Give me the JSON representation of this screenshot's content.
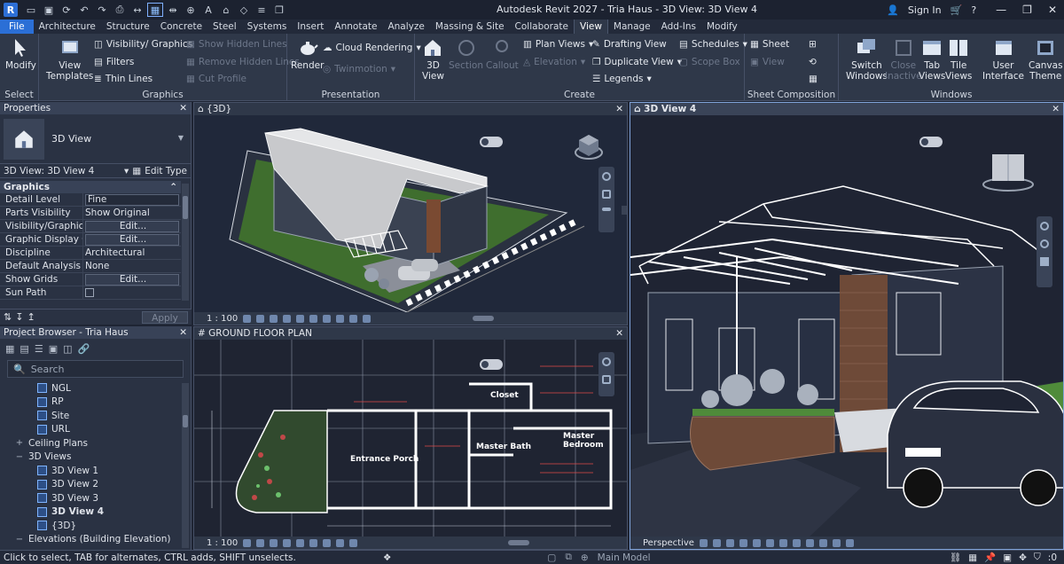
{
  "app": {
    "title": "Autodesk Revit 2027 - Tria Haus - 3D View: 3D View 4",
    "logo_letter": "R",
    "sign_in": "Sign In",
    "help": "?"
  },
  "tabs": [
    "File",
    "Architecture",
    "Structure",
    "Concrete",
    "Steel",
    "Systems",
    "Insert",
    "Annotate",
    "Analyze",
    "Massing & Site",
    "Collaborate",
    "View",
    "Manage",
    "Add-Ins",
    "Modify"
  ],
  "active_tab": "View",
  "ribbon": {
    "select": {
      "modify": "Modify",
      "title": "Select"
    },
    "graphics": {
      "view_templates_1": "View",
      "view_templates_2": "Templates",
      "visibility": "Visibility/ Graphics",
      "filters": "Filters",
      "thin_lines": "Thin Lines",
      "show_hidden": "Show Hidden Lines",
      "remove_hidden": "Remove Hidden Lines",
      "cut_profile": "Cut Profile",
      "title": "Graphics"
    },
    "presentation": {
      "render": "Render",
      "cloud": "Cloud Rendering",
      "twinmotion": "Twinmotion",
      "title": "Presentation"
    },
    "create": {
      "view3d_1": "3D",
      "view3d_2": "View",
      "section": "Section",
      "callout": "Callout",
      "plan_views": "Plan Views",
      "elevation": "Elevation",
      "drafting": "Drafting View",
      "duplicate": "Duplicate View",
      "legends": "Legends",
      "schedules": "Schedules",
      "scope_box": "Scope Box",
      "title": "Create"
    },
    "sheet": {
      "sheet": "Sheet",
      "view": "View",
      "title": "Sheet Composition"
    },
    "windows": {
      "switch_1": "Switch",
      "switch_2": "Windows",
      "close_1": "Close",
      "close_2": "Inactive",
      "tab_1": "Tab",
      "tab_2": "Views",
      "tile_1": "Tile",
      "tile_2": "Views",
      "user_1": "User",
      "user_2": "Interface",
      "canvas_1": "Canvas",
      "canvas_2": "Theme",
      "title": "Windows"
    }
  },
  "properties": {
    "title": "Properties",
    "type_name": "3D View",
    "view_selector": "3D View: 3D View 4",
    "edit_type": "Edit Type",
    "section": "Graphics",
    "rows": [
      {
        "k": "Detail Level",
        "v": "Fine",
        "kind": "box"
      },
      {
        "k": "Parts Visibility",
        "v": "Show Original",
        "kind": "text"
      },
      {
        "k": "Visibility/Graphics ...",
        "v": "Edit...",
        "kind": "btn"
      },
      {
        "k": "Graphic Display Op...",
        "v": "Edit...",
        "kind": "btn"
      },
      {
        "k": "Discipline",
        "v": "Architectural",
        "kind": "text"
      },
      {
        "k": "Default Analysis Dis...",
        "v": "None",
        "kind": "text"
      },
      {
        "k": "Show Grids",
        "v": "Edit...",
        "kind": "btn"
      },
      {
        "k": "Sun Path",
        "v": "",
        "kind": "check"
      }
    ],
    "apply": "Apply"
  },
  "browser": {
    "title": "Project Browser - Tria Haus",
    "search_placeholder": "Search",
    "items": [
      {
        "label": "NGL",
        "level": 3,
        "type": "view"
      },
      {
        "label": "RP",
        "level": 3,
        "type": "view"
      },
      {
        "label": "Site",
        "level": 3,
        "type": "view"
      },
      {
        "label": "URL",
        "level": 3,
        "type": "view"
      },
      {
        "label": "Ceiling Plans",
        "level": 1,
        "type": "expand",
        "exp": "+"
      },
      {
        "label": "3D Views",
        "level": 1,
        "type": "expand",
        "exp": "−"
      },
      {
        "label": "3D View 1",
        "level": 3,
        "type": "view"
      },
      {
        "label": "3D View 2",
        "level": 3,
        "type": "view"
      },
      {
        "label": "3D View 3",
        "level": 3,
        "type": "view"
      },
      {
        "label": "3D View 4",
        "level": 3,
        "type": "view",
        "bold": true
      },
      {
        "label": "{3D}",
        "level": 3,
        "type": "view"
      },
      {
        "label": "Elevations (Building Elevation)",
        "level": 1,
        "type": "expand",
        "exp": "−"
      }
    ]
  },
  "viewports": {
    "v3d": {
      "title": "{3D}",
      "scale": "1 : 100"
    },
    "plan": {
      "title": "# GROUND FLOOR PLAN",
      "scale": "1 : 100",
      "rooms": [
        "Entrance Porch",
        "Master Bath",
        "Master Bedroom",
        "Closet"
      ]
    },
    "persp": {
      "title": "3D View 4",
      "scale": "Perspective"
    }
  },
  "status": {
    "message": "Click to select, TAB for alternates, CTRL adds, SHIFT unselects.",
    "model": "Main Model",
    "zero": ":0"
  },
  "colors": {
    "accent": "#2b6fd6",
    "panel": "#2a3243",
    "ribbon": "#2f3849"
  }
}
